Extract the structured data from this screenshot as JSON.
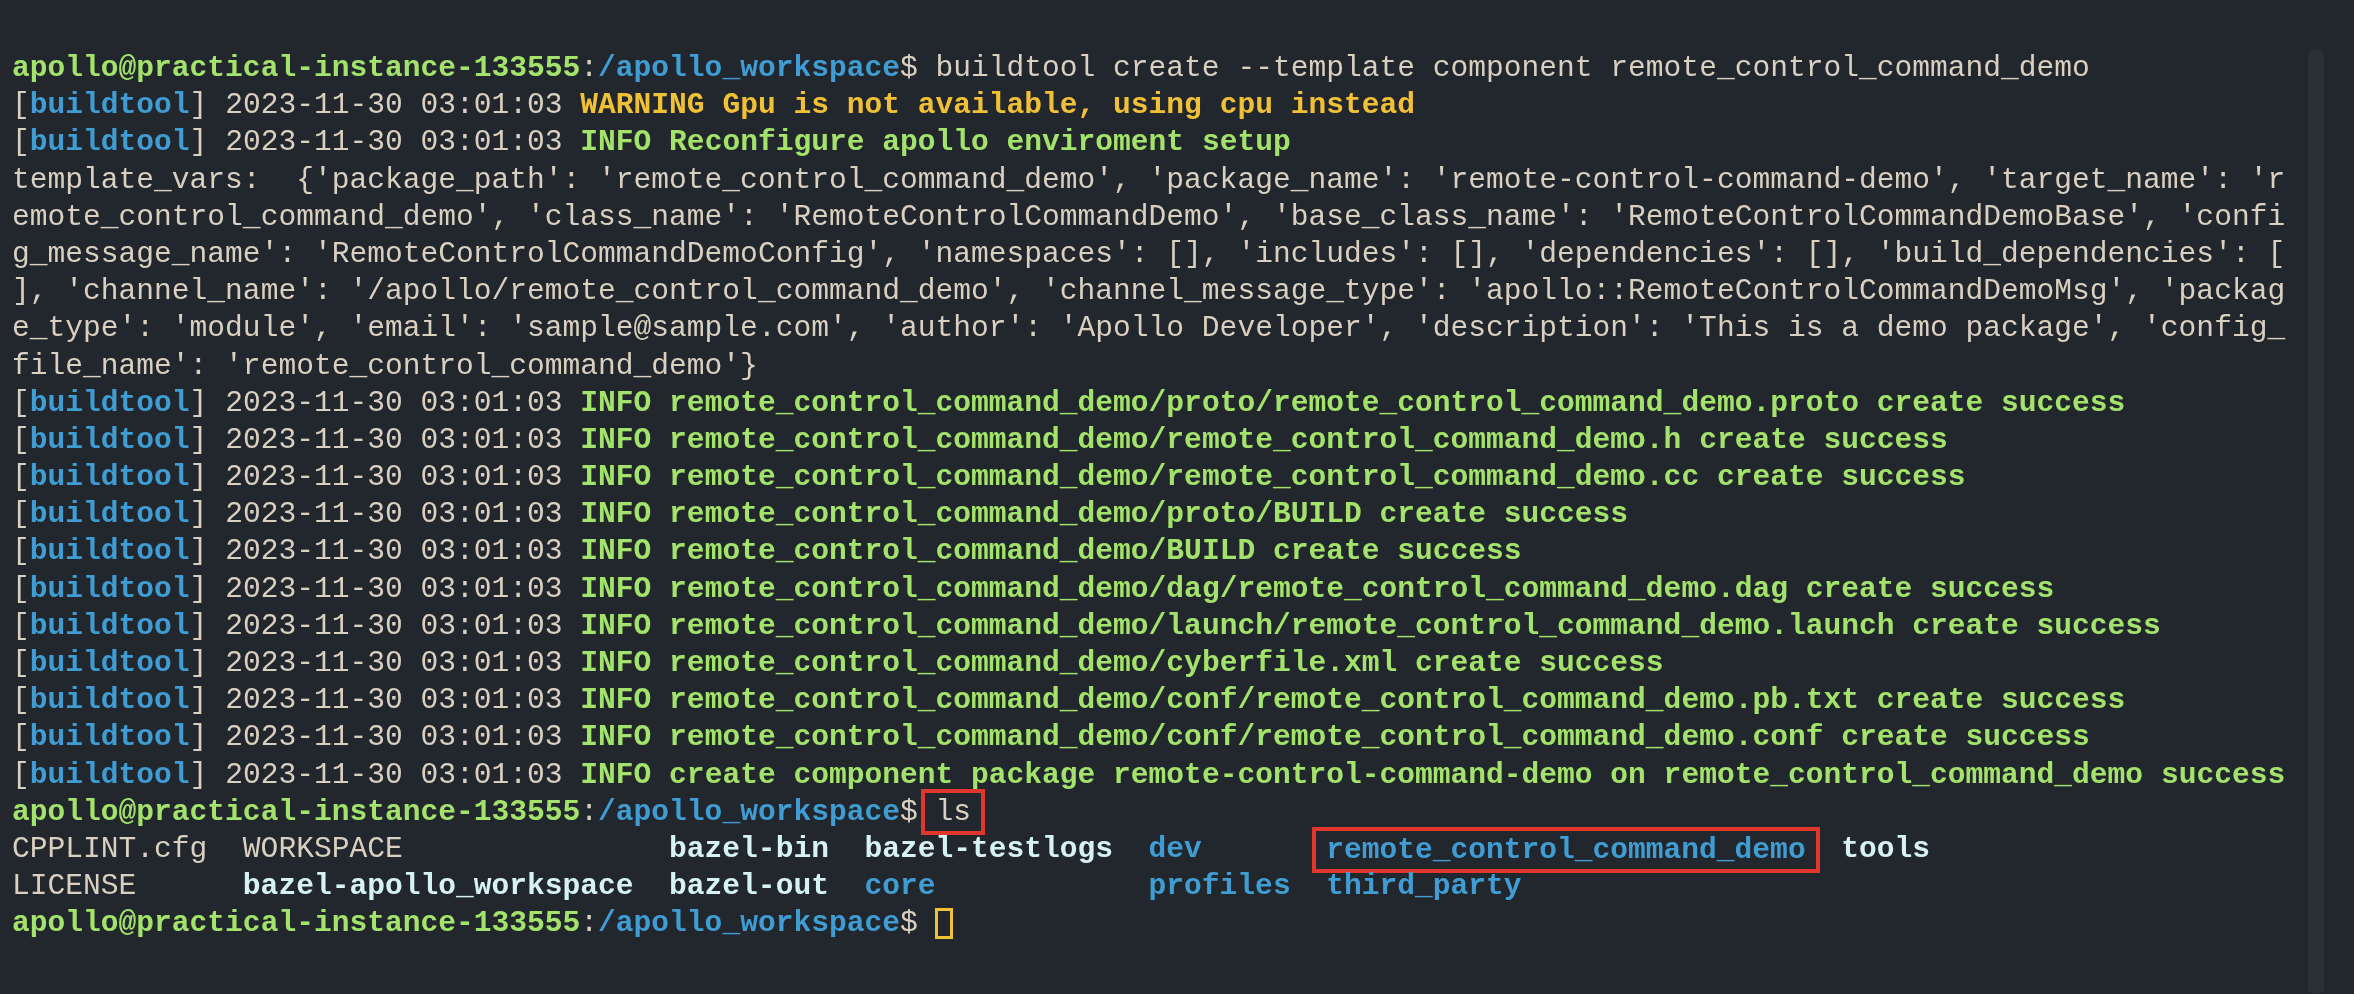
{
  "terminal": {
    "lines": [
      {
        "kind": "prompt",
        "user": "apollo@practical-instance-133555",
        "separator": ":",
        "path": "/apollo_workspace",
        "symbol": "$",
        "command": "buildtool create --template component remote_control_command_demo"
      },
      {
        "kind": "log",
        "open": "[",
        "tag": "buildtool",
        "close": "]",
        "time": "2023-11-30 03:01:03",
        "message": {
          "kind": "warning",
          "text": "WARNING Gpu is not available, using cpu instead"
        }
      },
      {
        "kind": "log",
        "open": "[",
        "tag": "buildtool",
        "close": "]",
        "time": "2023-11-30 03:01:03",
        "message": {
          "kind": "info",
          "text": "INFO Reconfigure apollo enviroment setup"
        }
      },
      {
        "kind": "text",
        "text": "template_vars:  {'package_path': 'remote_control_command_demo', 'package_name': 'remote-control-command-demo', 'target_name': 'r"
      },
      {
        "kind": "text",
        "text": "emote_control_command_demo', 'class_name': 'RemoteControlCommandDemo', 'base_class_name': 'RemoteControlCommandDemoBase', 'confi"
      },
      {
        "kind": "text",
        "text": "g_message_name': 'RemoteControlCommandDemoConfig', 'namespaces': [], 'includes': [], 'dependencies': [], 'build_dependencies': ["
      },
      {
        "kind": "text",
        "text": "], 'channel_name': '/apollo/remote_control_command_demo', 'channel_message_type': 'apollo::RemoteControlCommandDemoMsg', 'packag"
      },
      {
        "kind": "text",
        "text": "e_type': 'module', 'email': 'sample@sample.com', 'author': 'Apollo Developer', 'description': 'This is a demo package', 'config_"
      },
      {
        "kind": "text",
        "text": "file_name': 'remote_control_command_demo'}"
      },
      {
        "kind": "log",
        "open": "[",
        "tag": "buildtool",
        "close": "]",
        "time": "2023-11-30 03:01:03",
        "message": {
          "kind": "info",
          "text": "INFO remote_control_command_demo/proto/remote_control_command_demo.proto create success"
        }
      },
      {
        "kind": "log",
        "open": "[",
        "tag": "buildtool",
        "close": "]",
        "time": "2023-11-30 03:01:03",
        "message": {
          "kind": "info",
          "text": "INFO remote_control_command_demo/remote_control_command_demo.h create success"
        }
      },
      {
        "kind": "log",
        "open": "[",
        "tag": "buildtool",
        "close": "]",
        "time": "2023-11-30 03:01:03",
        "message": {
          "kind": "info",
          "text": "INFO remote_control_command_demo/remote_control_command_demo.cc create success"
        }
      },
      {
        "kind": "log",
        "open": "[",
        "tag": "buildtool",
        "close": "]",
        "time": "2023-11-30 03:01:03",
        "message": {
          "kind": "info",
          "text": "INFO remote_control_command_demo/proto/BUILD create success"
        }
      },
      {
        "kind": "log",
        "open": "[",
        "tag": "buildtool",
        "close": "]",
        "time": "2023-11-30 03:01:03",
        "message": {
          "kind": "info",
          "text": "INFO remote_control_command_demo/BUILD create success"
        }
      },
      {
        "kind": "log",
        "open": "[",
        "tag": "buildtool",
        "close": "]",
        "time": "2023-11-30 03:01:03",
        "message": {
          "kind": "info",
          "text": "INFO remote_control_command_demo/dag/remote_control_command_demo.dag create success"
        }
      },
      {
        "kind": "log",
        "open": "[",
        "tag": "buildtool",
        "close": "]",
        "time": "2023-11-30 03:01:03",
        "message": {
          "kind": "info",
          "text": "INFO remote_control_command_demo/launch/remote_control_command_demo.launch create success"
        }
      },
      {
        "kind": "log",
        "open": "[",
        "tag": "buildtool",
        "close": "]",
        "time": "2023-11-30 03:01:03",
        "message": {
          "kind": "info",
          "text": "INFO remote_control_command_demo/cyberfile.xml create success"
        }
      },
      {
        "kind": "log",
        "open": "[",
        "tag": "buildtool",
        "close": "]",
        "time": "2023-11-30 03:01:03",
        "message": {
          "kind": "info",
          "text": "INFO remote_control_command_demo/conf/remote_control_command_demo.pb.txt create success"
        }
      },
      {
        "kind": "log",
        "open": "[",
        "tag": "buildtool",
        "close": "]",
        "time": "2023-11-30 03:01:03",
        "message": {
          "kind": "info",
          "text": "INFO remote_control_command_demo/conf/remote_control_command_demo.conf create success"
        }
      },
      {
        "kind": "log",
        "open": "[",
        "tag": "buildtool",
        "close": "]",
        "time": "2023-11-30 03:01:03",
        "message": {
          "kind": "info",
          "text": "INFO create component package remote-control-command-demo on remote_control_command_demo success"
        }
      },
      {
        "kind": "prompt",
        "user": "apollo@practical-instance-133555",
        "separator": ":",
        "path": "/apollo_workspace",
        "symbol": "$",
        "command": "ls",
        "highlighted": true
      }
    ],
    "listing": [
      [
        {
          "kind": "file",
          "text": "CPPLINT.cfg"
        },
        {
          "kind": "file",
          "text": "WORKSPACE"
        },
        {
          "kind": "link",
          "text": "bazel-bin"
        },
        {
          "kind": "link",
          "text": "bazel-testlogs"
        },
        {
          "kind": "dir",
          "text": "dev"
        },
        {
          "kind": "dir",
          "text": "remote_control_command_demo",
          "highlighted": true
        },
        {
          "kind": "link",
          "text": "tools"
        }
      ],
      [
        {
          "kind": "file",
          "text": "LICENSE"
        },
        {
          "kind": "link",
          "text": "bazel-apollo_workspace"
        },
        {
          "kind": "link",
          "text": "bazel-out"
        },
        {
          "kind": "dir",
          "text": "core"
        },
        {
          "kind": "dir",
          "text": "profiles"
        },
        {
          "kind": "dir",
          "text": "third_party"
        }
      ]
    ],
    "final_prompt": {
      "user": "apollo@practical-instance-133555",
      "separator": ":",
      "path": "/apollo_workspace",
      "symbol": "$",
      "cursor": true
    }
  }
}
